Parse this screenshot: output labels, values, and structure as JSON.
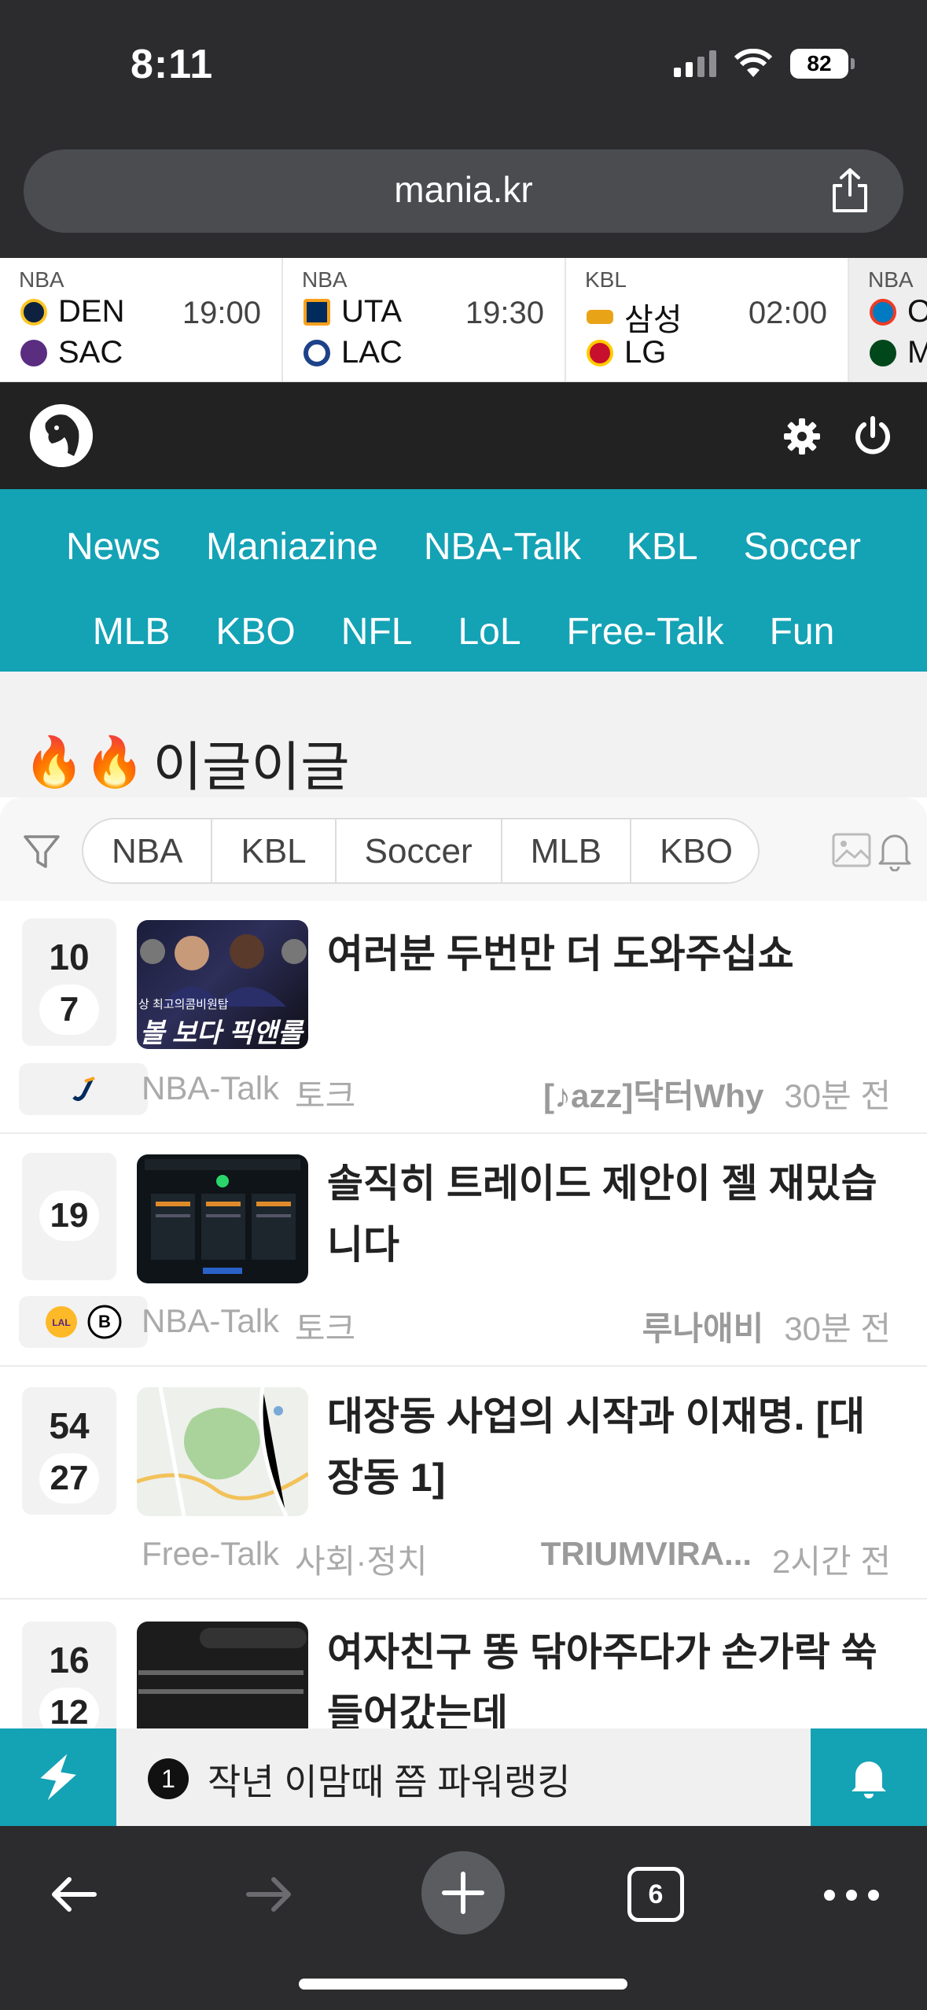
{
  "status": {
    "time": "8:11",
    "battery": "82"
  },
  "browser": {
    "url": "mania.kr",
    "tab_count": "6"
  },
  "scoreboard": [
    {
      "league": "NBA",
      "team1": "DEN",
      "team2": "SAC",
      "time": "19:00",
      "color1": "#0E2240",
      "color2": "#5A2D81"
    },
    {
      "league": "NBA",
      "team1": "UTA",
      "team2": "LAC",
      "time": "19:30",
      "color1": "#002B5C",
      "color2": "#1D428A"
    },
    {
      "league": "KBL",
      "team1": "삼성",
      "team2": "LG",
      "time": "02:00",
      "color1": "#E8A317",
      "color2": "#C8102E"
    },
    {
      "league": "NBA",
      "team1": "O",
      "team2": "M",
      "time": "",
      "color1": "#007AC1",
      "color2": "#00471B"
    }
  ],
  "nav": {
    "row1": [
      "News",
      "Maniazine",
      "NBA-Talk",
      "KBL",
      "Soccer"
    ],
    "row2": [
      "MLB",
      "KBO",
      "NFL",
      "LoL",
      "Free-Talk",
      "Fun"
    ]
  },
  "section": {
    "emoji": "🔥🔥",
    "title": "이글이글"
  },
  "filters": [
    "NBA",
    "KBL",
    "Soccer",
    "MLB",
    "KBO"
  ],
  "posts": [
    {
      "vote_top": "10",
      "vote_bottom": "7",
      "title": "여러분 두번만 더 도와주십쇼",
      "board": "NBA-Talk",
      "category": "토크",
      "author": "[♪azz]닥터Why",
      "time": "30분 전"
    },
    {
      "vote_top": "",
      "vote_bottom": "19",
      "title": "솔직히 트레이드 제안이 젤 재밌습니다",
      "board": "NBA-Talk",
      "category": "토크",
      "author": "루나애비",
      "time": "30분 전"
    },
    {
      "vote_top": "54",
      "vote_bottom": "27",
      "title": "대장동 사업의 시작과 이재명. [대장동 1]",
      "board": "Free-Talk",
      "category": "사회·정치",
      "author": "TRIUMVIRA...",
      "time": "2시간 전"
    },
    {
      "vote_top": "16",
      "vote_bottom": "12",
      "title": "여자친구 똥 닦아주다가 손가락 쑥 들어갔는데",
      "board": "",
      "category": "",
      "author": "",
      "time": ""
    }
  ],
  "thumb_text": {
    "post1": "볼 보다 픽앤롤",
    "post1_sub": "상 최고의콤비원탑"
  },
  "banner": {
    "rank": "1",
    "text": "작년 이맘때 쯤 파워랭킹"
  },
  "colors": {
    "accent": "#14A2B5",
    "header": "#222222",
    "browser": "#2C2C2E"
  }
}
